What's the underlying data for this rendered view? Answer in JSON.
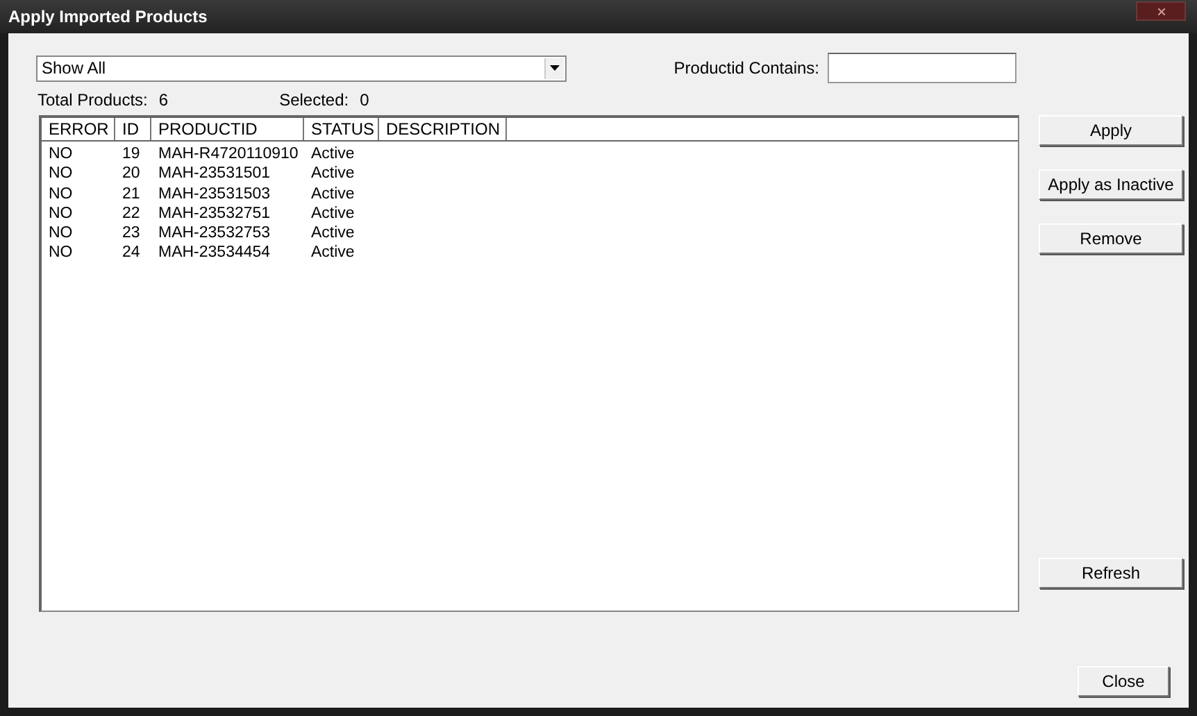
{
  "window": {
    "title": "Apply Imported Products"
  },
  "filter": {
    "value": "Show All"
  },
  "search": {
    "label": "Productid Contains:"
  },
  "totals": [
    {
      "label": "Total Products:",
      "value": "6"
    },
    {
      "label": "Selected:",
      "value": "0"
    }
  ],
  "table": {
    "columns": [
      "ERROR",
      "ID",
      "PRODUCTID",
      "STATUS",
      "DESCRIPTION"
    ],
    "rows": [
      [
        "NO",
        "19",
        "MAH-R4720110910",
        "Active"
      ],
      [
        "NO",
        "20",
        "MAH-23531501",
        "Active"
      ],
      [
        "NO",
        "21",
        "MAH-23531503",
        "Active"
      ],
      [
        "NO",
        "22",
        "MAH-23532751",
        "Active"
      ],
      [
        "NO",
        "23",
        "MAH-23532753",
        "Active"
      ],
      [
        "NO",
        "24",
        "MAH-23534454",
        "Active"
      ]
    ]
  },
  "side_buttons": [
    "Apply",
    "Apply as Inactive",
    "Remove"
  ],
  "lower_side_buttons": [
    "Refresh"
  ],
  "close_button": {
    "label": "Close"
  }
}
